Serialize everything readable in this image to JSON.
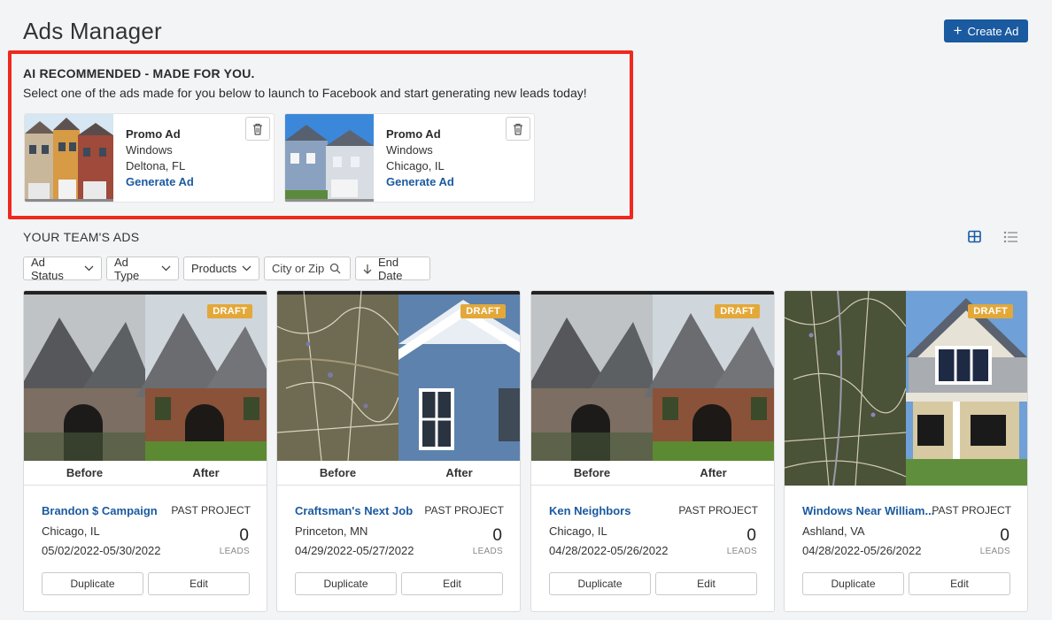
{
  "header": {
    "title": "Ads Manager",
    "create_label": "Create Ad"
  },
  "ai": {
    "title": "AI RECOMMENDED - MADE FOR YOU.",
    "subtitle": "Select one of the ads made for you below to launch to Facebook and start generating new leads today!",
    "promos": [
      {
        "title": "Promo Ad",
        "product": "Windows",
        "location": "Deltona, FL",
        "action": "Generate Ad"
      },
      {
        "title": "Promo Ad",
        "product": "Windows",
        "location": "Chicago, IL",
        "action": "Generate Ad"
      }
    ]
  },
  "team": {
    "title": "YOUR TEAM'S ADS",
    "filters": {
      "status": "Ad Status",
      "type": "Ad Type",
      "products": "Products",
      "city_placeholder": "City or Zip",
      "end_date": "End Date"
    },
    "cards": [
      {
        "badge": "DRAFT",
        "before": "Before",
        "after": "After",
        "title": "Brandon $ Campaign",
        "type": "PAST PROJECT",
        "location": "Chicago, IL",
        "dates": "05/02/2022-05/30/2022",
        "leads": "0",
        "leads_label": "LEADS",
        "duplicate": "Duplicate",
        "edit": "Edit"
      },
      {
        "badge": "DRAFT",
        "before": "Before",
        "after": "After",
        "title": "Craftsman's Next Job",
        "type": "PAST PROJECT",
        "location": "Princeton, MN",
        "dates": "04/29/2022-05/27/2022",
        "leads": "0",
        "leads_label": "LEADS",
        "duplicate": "Duplicate",
        "edit": "Edit"
      },
      {
        "badge": "DRAFT",
        "before": "Before",
        "after": "After",
        "title": "Ken Neighbors",
        "type": "PAST PROJECT",
        "location": "Chicago, IL",
        "dates": "04/28/2022-05/26/2022",
        "leads": "0",
        "leads_label": "LEADS",
        "duplicate": "Duplicate",
        "edit": "Edit"
      },
      {
        "badge": "DRAFT",
        "title": "Windows Near William...",
        "type": "PAST PROJECT",
        "location": "Ashland, VA",
        "dates": "04/28/2022-05/26/2022",
        "leads": "0",
        "leads_label": "LEADS",
        "duplicate": "Duplicate",
        "edit": "Edit"
      }
    ]
  },
  "colors": {
    "brand": "#1a5aa0",
    "highlight_border": "#f0281e",
    "draft_badge": "#e3a83a"
  },
  "icons": {
    "create": "plus-icon",
    "promo_delete": "trash-icon",
    "filter_dropdown": "chevron-down-icon",
    "city_search": "search-icon",
    "sort": "arrow-down-icon",
    "grid_view": "grid-view-icon",
    "list_view": "list-view-icon"
  }
}
